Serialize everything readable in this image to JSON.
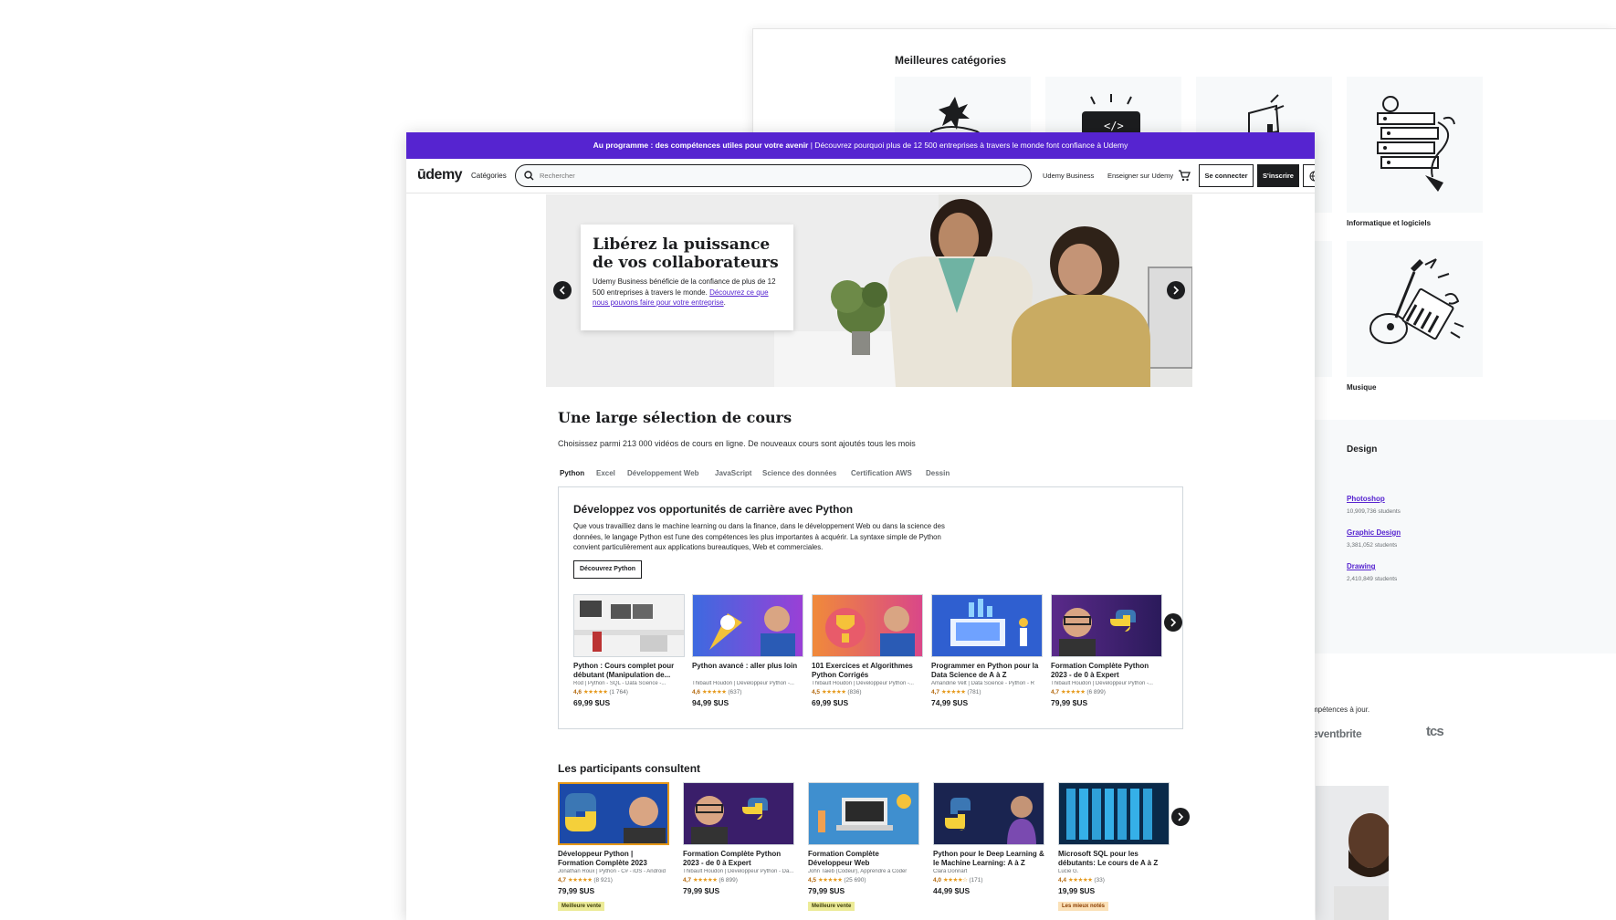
{
  "background_page": {
    "title": "Meilleures catégories",
    "categories": [
      {
        "name": ""
      },
      {
        "name": ""
      },
      {
        "name": ""
      },
      {
        "name": "Informatique et logiciels"
      },
      {
        "name": "Musique"
      }
    ],
    "design_section": {
      "title": "Design",
      "links": [
        {
          "label": "Photoshop",
          "students": "10,909,736 students"
        },
        {
          "label": "Graphic Design",
          "students": "3,381,052 students"
        },
        {
          "label": "Drawing",
          "students": "2,410,849 students"
        }
      ]
    },
    "fragment_heading": "e",
    "fragment_text": "mpétences à jour.",
    "logos": [
      "eventbrite",
      "tcs"
    ]
  },
  "banner": {
    "bold": "Au programme : des compétences utiles pour votre avenir",
    "text": " | Découvrez pourquoi plus de 12 500 entreprises à travers le monde font confiance à Udemy"
  },
  "header": {
    "logo": "ūdemy",
    "categories": "Catégories",
    "search_placeholder": "Rechercher",
    "business": "Udemy Business",
    "teach": "Enseigner sur Udemy",
    "login": "Se connecter",
    "signup": "S'inscrire"
  },
  "hero": {
    "title": "Libérez la puissance de vos collaborateurs",
    "text": "Udemy Business bénéficie de la confiance de plus de 12 500 entreprises à travers le monde. ",
    "link": "Découvrez ce que nous pouvons faire pour votre entreprise",
    "after_link": "."
  },
  "selection": {
    "title": "Une large sélection de cours",
    "description": "Choisissez parmi 213 000 vidéos de cours en ligne. De nouveaux cours sont ajoutés tous les mois",
    "tabs": [
      "Python",
      "Excel",
      "Développement Web",
      "JavaScript",
      "Science des données",
      "Certification AWS",
      "Dessin"
    ],
    "box": {
      "title": "Développez vos opportunités de carrière avec Python",
      "description": "Que vous travailliez dans le machine learning ou dans la finance, dans le développement Web ou dans la science des données, le langage Python est l'une des compétences les plus importantes à acquérir. La syntaxe simple de Python convient particulièrement aux applications bureautiques, Web et commerciales.",
      "button": "Découvrez Python"
    },
    "courses": [
      {
        "title": "Python : Cours complet pour débutant (Manipulation de...",
        "author": "Rod | Python - SQL - Data Science -...",
        "rating": "4,6",
        "stars": "★★★★★",
        "count": "(1 764)",
        "price": "69,99 $US"
      },
      {
        "title": "Python avancé : aller plus loin",
        "author": "Thibault Houdon | Développeur Python -...",
        "rating": "4,6",
        "stars": "★★★★★",
        "count": "(637)",
        "price": "94,99 $US"
      },
      {
        "title": "101 Exercices et Algorithmes Python Corrigés",
        "author": "Thibault Houdon | Développeur Python -...",
        "rating": "4,5",
        "stars": "★★★★★",
        "count": "(836)",
        "price": "69,99 $US"
      },
      {
        "title": "Programmer en Python pour la Data Science de A à Z",
        "author": "Amandine Velt | Data Science - Python - R",
        "rating": "4,7",
        "stars": "★★★★★",
        "count": "(781)",
        "price": "74,99 $US"
      },
      {
        "title": "Formation Complète Python 2023 - de 0 à Expert",
        "author": "Thibault Houdon | Développeur Python -...",
        "rating": "4,7",
        "stars": "★★★★★",
        "count": "(6 899)",
        "price": "79,99 $US"
      }
    ]
  },
  "participants": {
    "title": "Les participants consultent",
    "courses": [
      {
        "title": "Développeur Python | Formation Complète 2023",
        "author": "Jonathan Roux | Python - C# - iOS - Android",
        "rating": "4,7",
        "stars": "★★★★★",
        "count": "(8 921)",
        "price": "79,99 $US",
        "badge": "Meilleure vente"
      },
      {
        "title": "Formation Complète Python 2023 - de 0 à Expert",
        "author": "Thibault Houdon | Développeur Python - Da...",
        "rating": "4,7",
        "stars": "★★★★★",
        "count": "(6 899)",
        "price": "79,99 $US",
        "badge": ""
      },
      {
        "title": "Formation Complète Développeur Web",
        "author": "John Taieb (Codeur), Apprendre à Coder",
        "rating": "4,5",
        "stars": "★★★★★",
        "count": "(25 690)",
        "price": "79,99 $US",
        "badge": "Meilleure vente"
      },
      {
        "title": "Python pour le Deep Learning & le Machine Learning: A à Z",
        "author": "Clara Donnart",
        "rating": "4,0",
        "stars": "★★★★☆",
        "count": "(171)",
        "price": "44,99 $US",
        "badge": ""
      },
      {
        "title": "Microsoft SQL pour les débutants: Le cours de A à Z",
        "author": "Lucie G.",
        "rating": "4,4",
        "stars": "★★★★★",
        "count": "(33)",
        "price": "19,99 $US",
        "badge": "Les mieux notés"
      }
    ]
  }
}
